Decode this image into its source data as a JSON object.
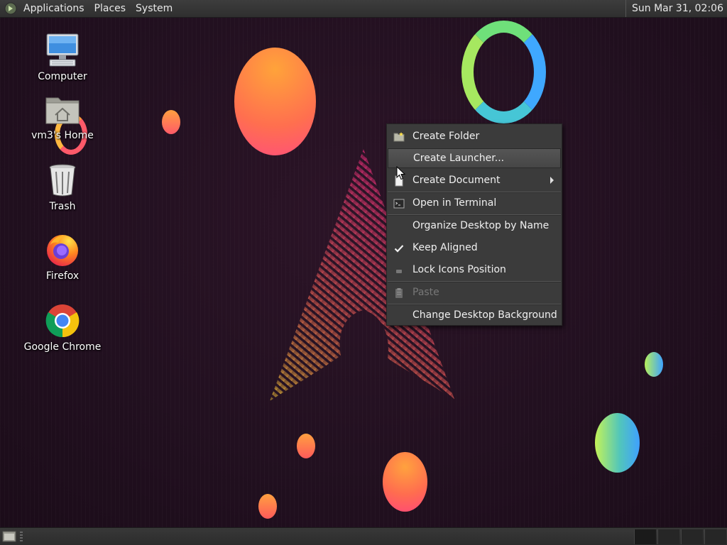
{
  "top_panel": {
    "menus": [
      "Applications",
      "Places",
      "System"
    ],
    "clock": "Sun Mar 31, 02:06"
  },
  "desktop_icons": [
    {
      "label": "Computer",
      "icon": "computer-icon"
    },
    {
      "label": "vm3's Home",
      "icon": "home-folder-icon"
    },
    {
      "label": "Trash",
      "icon": "trash-icon"
    },
    {
      "label": "Firefox",
      "icon": "firefox-icon"
    },
    {
      "label": "Google Chrome",
      "icon": "chrome-icon"
    }
  ],
  "context_menu": {
    "items": [
      {
        "label": "Create Folder",
        "icon": "folder-new-icon"
      },
      {
        "label": "Create Launcher...",
        "state": "hovered"
      },
      {
        "label": "Create Document",
        "icon": "document-icon",
        "submenu": true
      },
      {
        "label": "Open in Terminal",
        "icon": "terminal-icon"
      },
      {
        "label": "Organize Desktop by Name"
      },
      {
        "label": "Keep Aligned",
        "checked": true
      },
      {
        "label": "Lock Icons Position",
        "icon": "lock-icon"
      },
      {
        "label": "Paste",
        "icon": "paste-icon",
        "disabled": true
      },
      {
        "label": "Change Desktop Background"
      }
    ]
  },
  "colors": {
    "panel": "#333333",
    "menu_bg": "#3b3b3b",
    "wallpaper": "#22101d"
  }
}
